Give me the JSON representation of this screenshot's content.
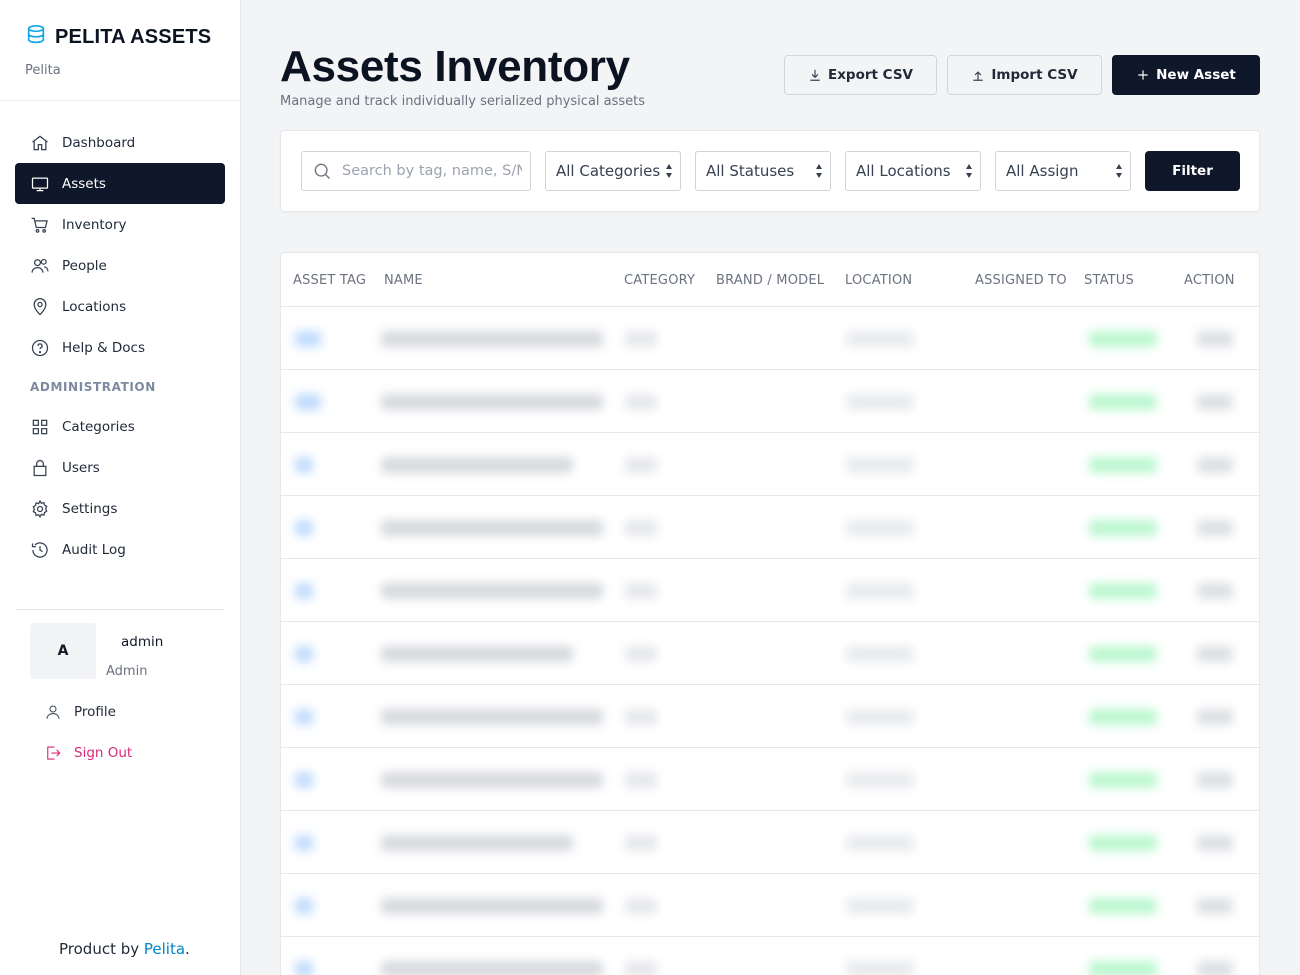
{
  "brand": {
    "name": "PELITA ASSETS",
    "subtitle": "Pelita"
  },
  "nav": {
    "items": [
      {
        "label": "Dashboard",
        "icon": "home-icon",
        "active": false
      },
      {
        "label": "Assets",
        "icon": "monitor-icon",
        "active": true
      },
      {
        "label": "Inventory",
        "icon": "cart-icon",
        "active": false
      },
      {
        "label": "People",
        "icon": "users-icon",
        "active": false
      },
      {
        "label": "Locations",
        "icon": "map-pin-icon",
        "active": false
      },
      {
        "label": "Help & Docs",
        "icon": "help-icon",
        "active": false
      }
    ],
    "admin_section": "ADMINISTRATION",
    "admin_items": [
      {
        "label": "Categories",
        "icon": "grid-icon"
      },
      {
        "label": "Users",
        "icon": "lock-icon"
      },
      {
        "label": "Settings",
        "icon": "gear-icon"
      },
      {
        "label": "Audit Log",
        "icon": "history-icon"
      }
    ]
  },
  "user": {
    "initial": "A",
    "name": "admin",
    "role": "Admin",
    "profile_label": "Profile",
    "signout_label": "Sign Out"
  },
  "footer": {
    "prefix": "Product by ",
    "link": "Pelita",
    "suffix": "."
  },
  "header": {
    "title": "Assets Inventory",
    "subtitle": "Manage and track individually serialized physical assets",
    "export_label": "Export CSV",
    "import_label": "Import CSV",
    "new_label": "New Asset"
  },
  "filters": {
    "search_placeholder": "Search by tag, name, S/N",
    "category": "All Categories",
    "status": "All Statuses",
    "location": "All Locations",
    "assign": "All Assign",
    "filter_label": "Filter"
  },
  "table": {
    "columns": [
      "ASSET TAG",
      "NAME",
      "CATEGORY",
      "BRAND / MODEL",
      "LOCATION",
      "ASSIGNED TO",
      "STATUS",
      "ACTION"
    ],
    "row_count": 11
  },
  "colors": {
    "sidebar_active": "#0f172a",
    "accent_link": "#0284c7",
    "signout": "#db2777",
    "status_green": "#bbf7d0",
    "tag_blue": "#bfdbfe"
  }
}
